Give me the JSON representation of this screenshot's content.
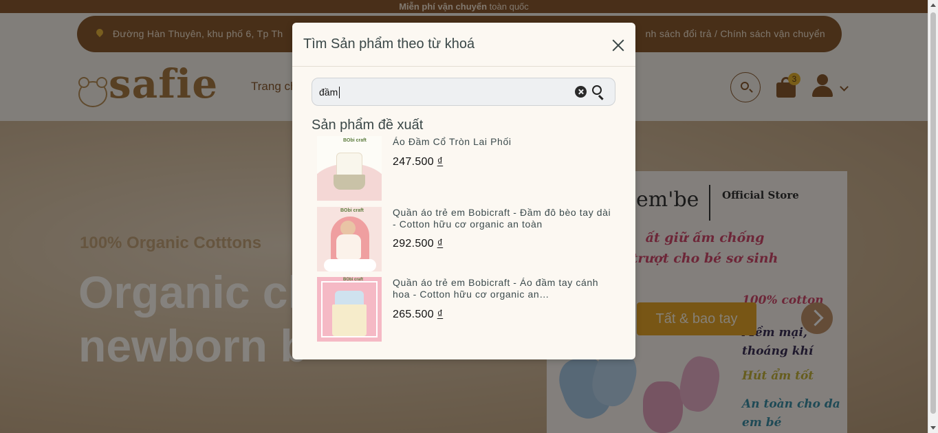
{
  "topbar": {
    "bold": "Miễn phí vận chuyển",
    "rest": " toàn quốc"
  },
  "header": {
    "address": "Đường Hàn Thuyên, khu phố 6, Tp Th",
    "policies": "nh sách đổi trả  /  Chính sách vận chuyển",
    "logo_text": "safie",
    "nav_home": "Trang ch",
    "cart_count": "3"
  },
  "hero": {
    "subtitle": "100% Organic Cotttons",
    "headline": "Organic cl             newborn b",
    "banner": {
      "brand": "em'be",
      "official": "Official Store",
      "slogan": "ất giữ ấm chống trượt cho bé sơ sinh",
      "feat1": "100% cotton",
      "feat2": "Mềm mại, thoáng khí",
      "feat3": "Hút ẩm tốt",
      "feat4": "An toàn cho da em bé"
    },
    "category_label": "Tất & bao tay"
  },
  "modal": {
    "title": "Tìm Sản phẩm theo từ khoá",
    "search_value": "đầm",
    "suggest_heading": "Sản phẩm đề xuất",
    "products": [
      {
        "name": "Áo Đầm Cổ Tròn Lai Phối",
        "price": "247.500 ",
        "currency": "₫"
      },
      {
        "name": "Quần áo trẻ em Bobicraft - Đầm đô bèo tay dài - Cotton hữu cơ organic an toàn",
        "price": "292.500 ",
        "currency": "₫"
      },
      {
        "name": "Quần áo trẻ em Bobicraft - Áo đầm tay cánh hoa - Cotton hữu cơ organic an…",
        "price": "265.500 ",
        "currency": "₫"
      }
    ],
    "thumb_tag": "BObi craft"
  }
}
